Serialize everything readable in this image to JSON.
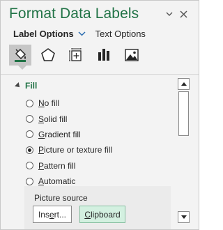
{
  "pane": {
    "title": "Format Data Labels",
    "dropdown_icon": "chevron-down-icon",
    "close_icon": "close-icon"
  },
  "tabs": {
    "active": "Label Options",
    "inactive": "Text Options"
  },
  "icon_tabs": [
    {
      "name": "fill-line-icon",
      "selected": true
    },
    {
      "name": "effects-icon",
      "selected": false
    },
    {
      "name": "size-properties-icon",
      "selected": false
    },
    {
      "name": "label-options-icon",
      "selected": false
    },
    {
      "name": "picture-icon",
      "selected": false
    }
  ],
  "fill": {
    "section_title": "Fill",
    "options": [
      {
        "access": "N",
        "rest": "o fill",
        "selected": false
      },
      {
        "access": "S",
        "rest": "olid fill",
        "selected": false
      },
      {
        "access": "G",
        "rest": "radient fill",
        "selected": false
      },
      {
        "access": "P",
        "rest": "icture or texture fill",
        "selected": true
      },
      {
        "access": "P",
        "rest": "attern fill",
        "selected": false
      },
      {
        "access": "A",
        "rest": "utomatic",
        "selected": false
      }
    ]
  },
  "picture_source": {
    "label": "Picture source",
    "insert_pre": "Ins",
    "insert_access": "e",
    "insert_post": "rt...",
    "clipboard_access": "C",
    "clipboard_post": "lipboard"
  },
  "colors": {
    "accent": "#217346",
    "clipboard_bg": "#d3f0e0",
    "selected_tab_bg": "#c6c6c6"
  }
}
